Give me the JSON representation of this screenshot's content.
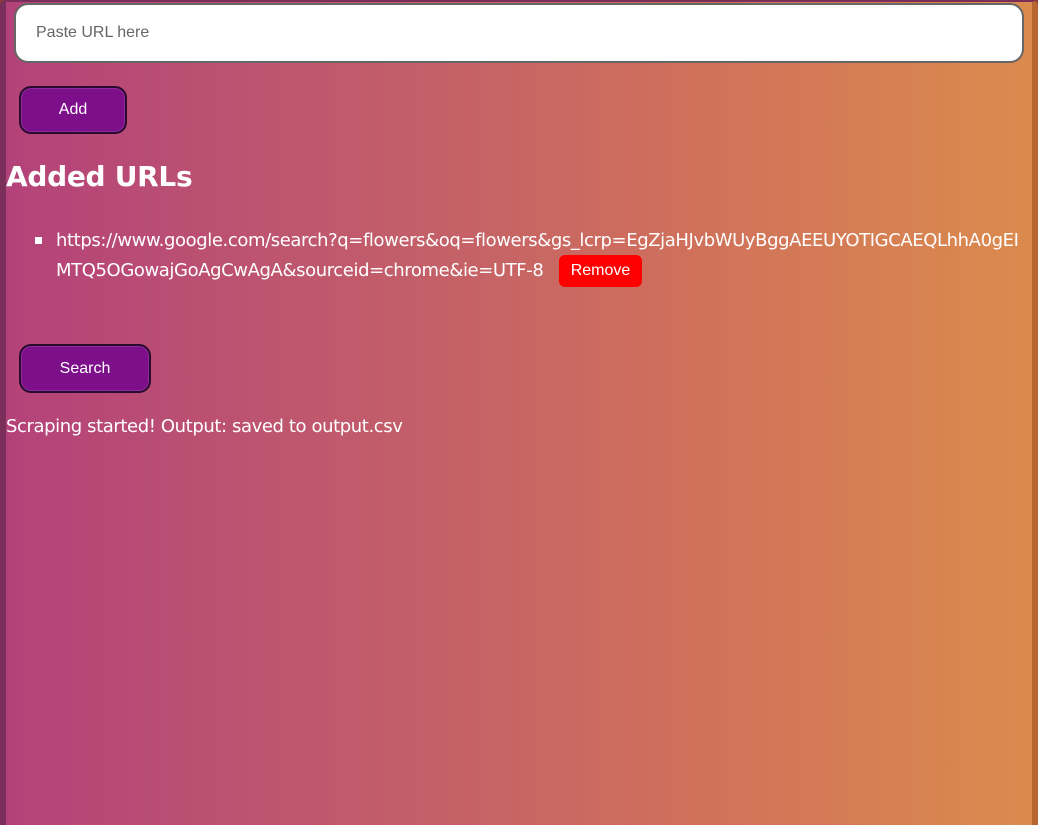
{
  "input": {
    "placeholder": "Paste URL here",
    "value": ""
  },
  "add_button": {
    "label": "Add"
  },
  "heading": "Added URLs",
  "urls": [
    {
      "url": "https://www.google.com/search?q=flowers&oq=flowers&gs_lcrp=EgZjaHJvbWUyBggAEEUYOTIGCAEQLhhA0gEIMTQ5OGowajGoAgCwAgA&sourceid=chrome&ie=UTF-8",
      "remove_label": "Remove"
    }
  ],
  "search_button": {
    "label": "Search"
  },
  "status": "Scraping started! Output: saved to output.csv",
  "colors": {
    "button_purple": "#7d0f8a",
    "remove_red": "#ff0000",
    "gradient_start": "#b4427a",
    "gradient_end": "#db8b4d"
  }
}
